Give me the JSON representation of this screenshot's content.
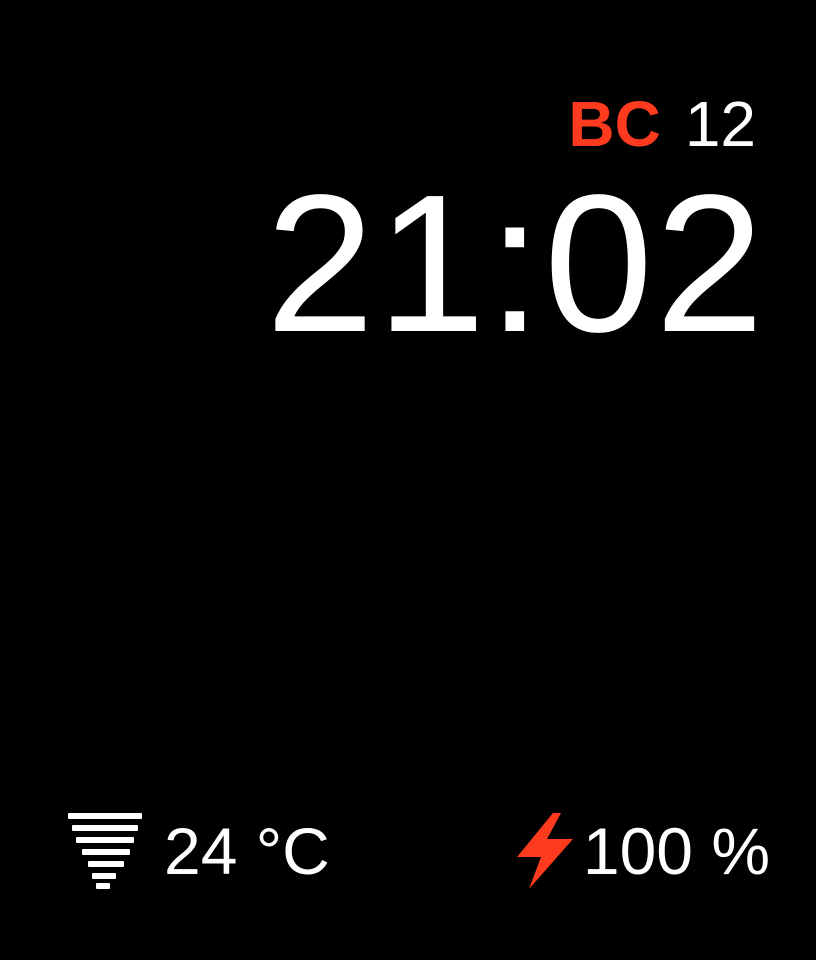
{
  "date": {
    "day_abbr": "BC",
    "day_number": "12"
  },
  "time": "21:02",
  "weather": {
    "icon": "fog-icon",
    "temperature": "24 °C"
  },
  "battery": {
    "icon": "lightning-bolt-icon",
    "level_text": "100 %",
    "level_percent": 100
  },
  "colors": {
    "background": "#000000",
    "text": "#ffffff",
    "accent": "#ff3b1f"
  }
}
